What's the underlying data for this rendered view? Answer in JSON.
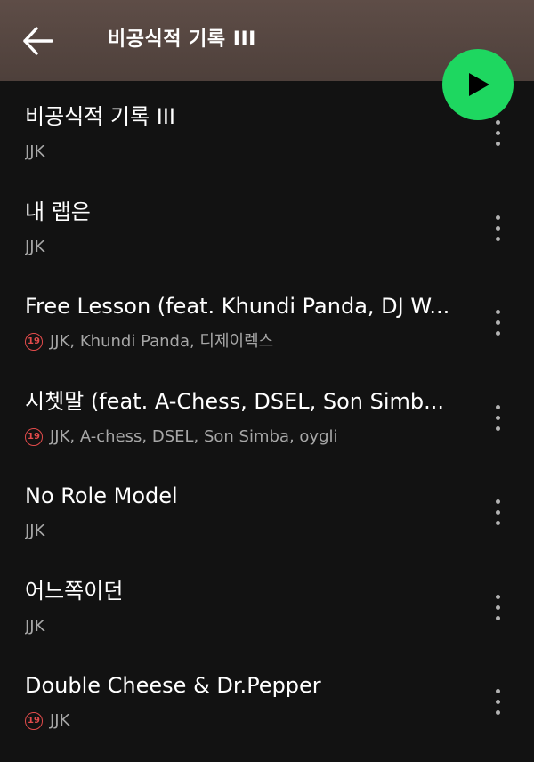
{
  "header": {
    "title": "비공식적 기록 III"
  },
  "colors": {
    "accent": "#1ed760",
    "header_bg": "#5e4d47",
    "background": "#121212",
    "explicit": "#e24b4b"
  },
  "icons": {
    "back": "arrow-left-icon",
    "play": "play-icon",
    "more": "more-vertical-icon",
    "explicit": "explicit-19-icon"
  },
  "explicit_badge": "19",
  "tracks": [
    {
      "title": "비공식적 기록 III",
      "artists": "JJK",
      "explicit": false
    },
    {
      "title": "내 랩은",
      "artists": "JJK",
      "explicit": false
    },
    {
      "title": "Free Lesson (feat. Khundi Panda, DJ W...",
      "artists": "JJK, Khundi Panda, 디제이렉스",
      "explicit": true
    },
    {
      "title": "시쳇말 (feat. A-Chess, DSEL, Son Simb...",
      "artists": "JJK, A-chess, DSEL, Son Simba, oygli",
      "explicit": true
    },
    {
      "title": "No Role Model",
      "artists": "JJK",
      "explicit": false
    },
    {
      "title": "어느쪽이던",
      "artists": "JJK",
      "explicit": false
    },
    {
      "title": "Double Cheese & Dr.Pepper",
      "artists": "JJK",
      "explicit": true
    }
  ]
}
